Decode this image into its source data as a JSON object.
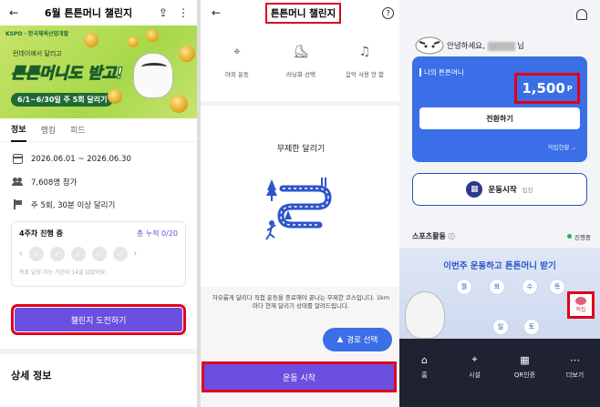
{
  "panel1": {
    "title": "6월 튼튼머니 챌린지",
    "banner": {
      "logos": "KSPO · 한국체육산업개발",
      "small": "런데이에서 달리고",
      "big": "튼튼머니도 받고!",
      "pill": "6/1~6/30일 주 5회 달리기"
    },
    "tabs": [
      "정보",
      "랭킹",
      "피드"
    ],
    "info": {
      "period": "2026.06.01 ~ 2026.06.30",
      "participants": "7,608명 참가",
      "goal": "주 5회, 30분 이상 달리기"
    },
    "progress": {
      "week": "4주차 진행 중",
      "cumulative": "총 누적 0/20",
      "note": "목표 달성 가능 기간이 14일 남았어요."
    },
    "cta": "챌린지 도전하기",
    "detail_heading": "상세 정보"
  },
  "panel2": {
    "title": "튼튼머니 챌린지",
    "options": [
      {
        "label": "야외 운동",
        "icon": "location-pin-icon"
      },
      {
        "label": "러닝화 선택",
        "icon": "running-shoe-icon"
      },
      {
        "label": "음악 사용 안 함",
        "icon": "music-note-icon"
      }
    ],
    "mode_title": "무제한 달리기",
    "description": "자유롭게 달리다 직접 운동을 종료해야 끝나는 무제한 코스입니다. 1km마다 현재 달리기 상태를 알려드립니다.",
    "route_button": "경로 선택",
    "start_button": "운동 시작"
  },
  "panel3": {
    "greeting": "안녕하세요,",
    "greeting_suffix": "님",
    "card_label": "나의 튼튼머니",
    "points": "1,500",
    "points_unit": "P",
    "convert_button": "전환하기",
    "accumulation_status": "적립현황",
    "exercise_button": "운동시작",
    "exercise_sub": "입장",
    "sports_label": "스포츠활동",
    "status": "진행중",
    "sports_title": "이번주 운동하고 튼튼머니 받기",
    "days": [
      "월",
      "화",
      "수",
      "목",
      "일",
      "토"
    ],
    "stamp_label": "적립",
    "nav": [
      {
        "label": "홈",
        "icon": "home-icon"
      },
      {
        "label": "시설",
        "icon": "location-pin-icon"
      },
      {
        "label": "QR인증",
        "icon": "qr-code-icon"
      },
      {
        "label": "더보기",
        "icon": "more-dots-icon"
      }
    ]
  },
  "colors": {
    "accent_purple": "#6b4fe0",
    "accent_blue": "#3a6fe8",
    "highlight_red": "#e0001b",
    "banner_green": "#a8d84a"
  }
}
